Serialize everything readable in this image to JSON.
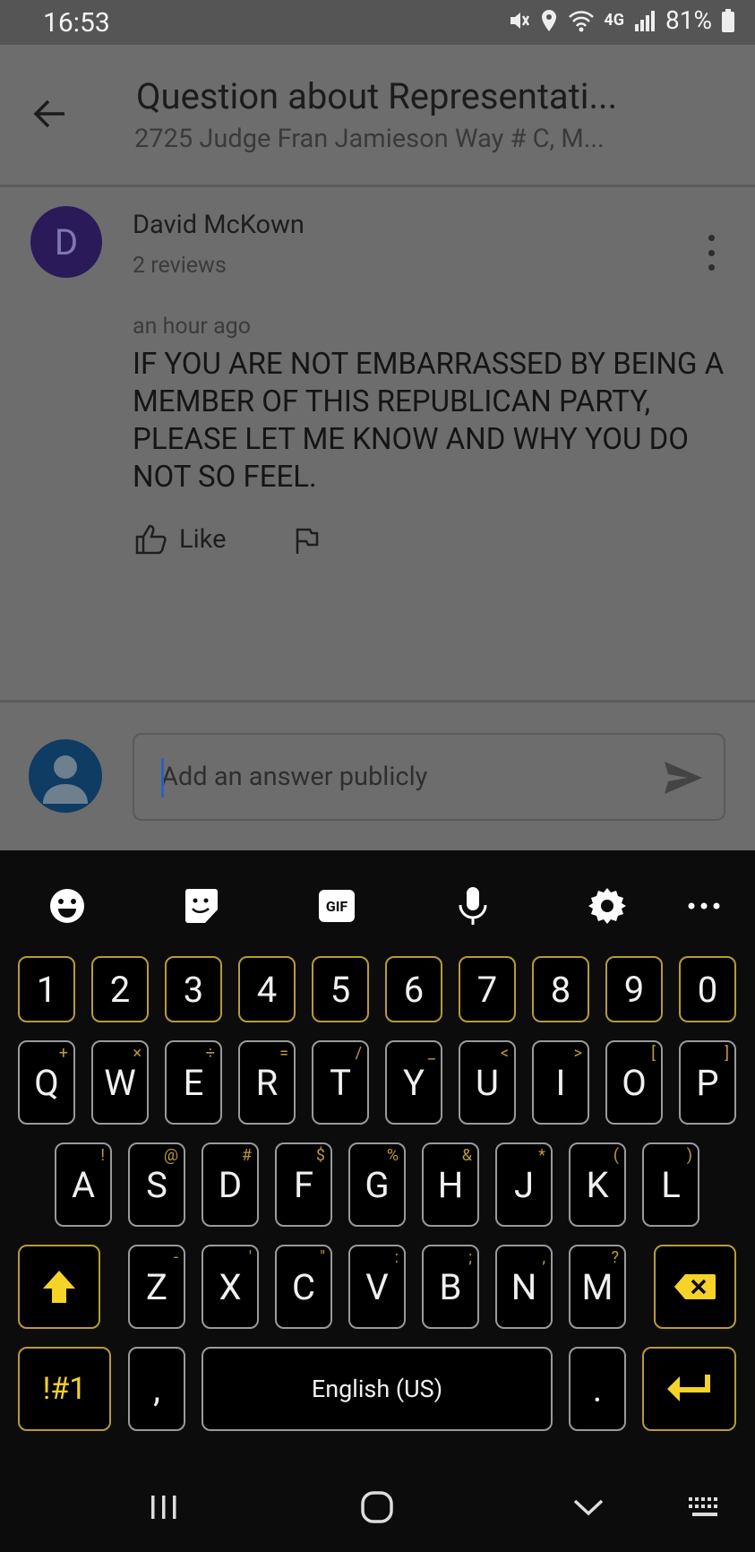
{
  "status_bar": {
    "time": "16:53",
    "battery": "81%",
    "network": "4G"
  },
  "header": {
    "title": "Question about Representati...",
    "subtitle": "2725 Judge Fran Jamieson Way # C, M..."
  },
  "question": {
    "avatar_letter": "D",
    "author": "David McKown",
    "reviews": "2 reviews",
    "time_ago": "an hour ago",
    "body": "IF YOU ARE NOT EMBARRASSED BY BEING A MEMBER OF THIS REPUBLICAN PARTY, PLEASE LET ME KNOW AND WHY YOU DO NOT SO FEEL.",
    "like_label": "Like"
  },
  "answer": {
    "placeholder": "Add an answer publicly"
  },
  "keyboard": {
    "toolbar": [
      "emoji-icon",
      "sticker-icon",
      "gif-icon",
      "microphone-icon",
      "settings-icon",
      "more-icon"
    ],
    "gif_label": "GIF",
    "number_row": [
      "1",
      "2",
      "3",
      "4",
      "5",
      "6",
      "7",
      "8",
      "9",
      "0"
    ],
    "row1": [
      "Q",
      "W",
      "E",
      "R",
      "T",
      "Y",
      "U",
      "I",
      "O",
      "P"
    ],
    "row1_sub": [
      "+",
      "×",
      "÷",
      "=",
      "/",
      "_",
      "<",
      ">",
      "[",
      "]"
    ],
    "row2": [
      "A",
      "S",
      "D",
      "F",
      "G",
      "H",
      "J",
      "K",
      "L"
    ],
    "row2_sub": [
      "!",
      "@",
      "#",
      "$",
      "%",
      "&",
      "*",
      "(",
      ")"
    ],
    "row3": [
      "Z",
      "X",
      "C",
      "V",
      "B",
      "N",
      "M"
    ],
    "row3_sub": [
      "-",
      "'",
      "\"",
      ":",
      ";",
      ",",
      "?"
    ],
    "symbols_label": "!#1",
    "comma": ",",
    "space_label": "English (US)",
    "period": ".",
    "accent_color": "#f5d327"
  }
}
